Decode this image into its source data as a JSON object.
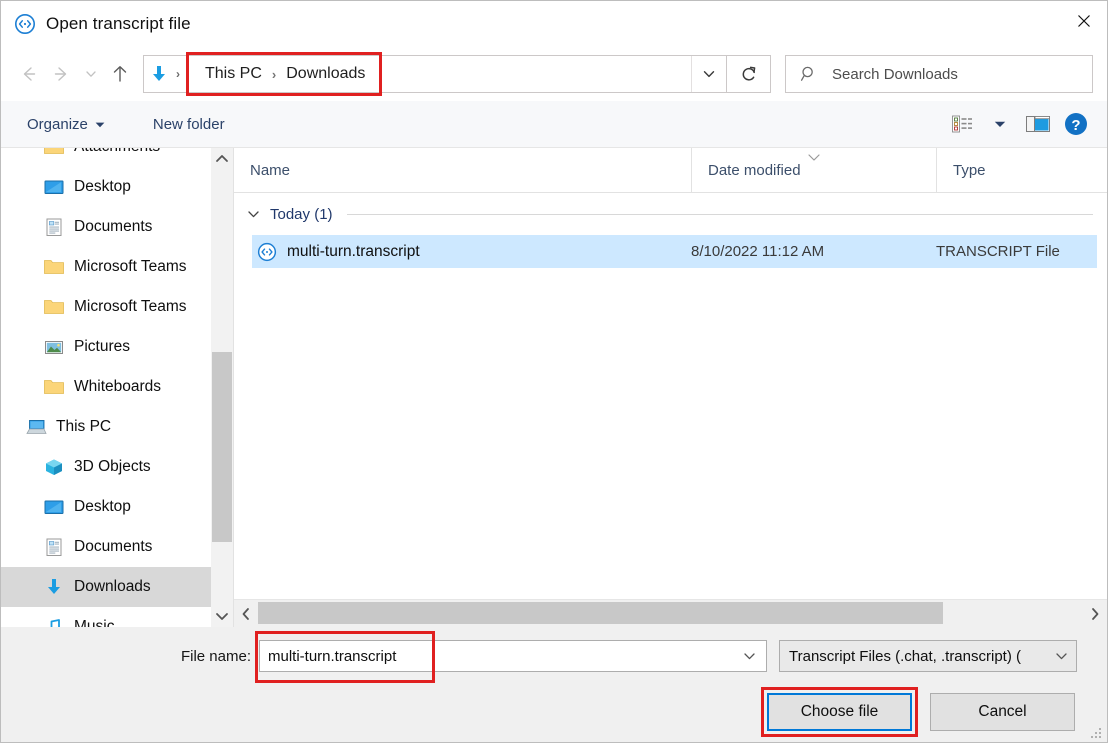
{
  "window": {
    "title": "Open transcript file",
    "title_icon": "transcript-file-icon",
    "close_label": "✕"
  },
  "nav": {
    "back_label": "Back",
    "forward_label": "Forward",
    "recent_label": "Recent locations",
    "up_label": "Up",
    "address_icon": "downloads-arrow-icon",
    "breadcrumbs": [
      "This PC",
      "Downloads"
    ],
    "breadcrumb_separator": "›",
    "dropdown_label": "Previous locations",
    "refresh_label": "Refresh",
    "highlight_color": "#e02020"
  },
  "search": {
    "placeholder": "Search Downloads",
    "value": "",
    "icon": "search-icon"
  },
  "commandbar": {
    "organize_label": "Organize",
    "new_folder_label": "New folder",
    "view_label": "Change your view",
    "view_dropdown_label": "More options",
    "preview_pane_label": "Show the preview pane",
    "help_label": "Get help",
    "help_glyph": "?"
  },
  "sidebar": {
    "items": [
      {
        "label": "Attachments",
        "icon": "folder-icon",
        "level": "child",
        "selected": false
      },
      {
        "label": "Desktop",
        "icon": "desktop-icon",
        "level": "child",
        "selected": false
      },
      {
        "label": "Documents",
        "icon": "documents-icon",
        "level": "child",
        "selected": false
      },
      {
        "label": "Microsoft Teams",
        "icon": "folder-icon",
        "level": "child",
        "selected": false
      },
      {
        "label": "Microsoft Teams",
        "icon": "folder-icon",
        "level": "child",
        "selected": false
      },
      {
        "label": "Pictures",
        "icon": "pictures-icon",
        "level": "child",
        "selected": false
      },
      {
        "label": "Whiteboards",
        "icon": "folder-icon",
        "level": "child",
        "selected": false
      },
      {
        "label": "This PC",
        "icon": "this-pc-icon",
        "level": "root",
        "selected": false
      },
      {
        "label": "3D Objects",
        "icon": "3d-objects-icon",
        "level": "child",
        "selected": false
      },
      {
        "label": "Desktop",
        "icon": "desktop-icon",
        "level": "child",
        "selected": false
      },
      {
        "label": "Documents",
        "icon": "documents-icon",
        "level": "child",
        "selected": false
      },
      {
        "label": "Downloads",
        "icon": "downloads-arrow-icon",
        "level": "child",
        "selected": true
      },
      {
        "label": "Music",
        "icon": "music-icon",
        "level": "child",
        "selected": false
      }
    ]
  },
  "filelist": {
    "columns": [
      {
        "label": "Name",
        "sorted": false
      },
      {
        "label": "Date modified",
        "sorted": true
      },
      {
        "label": "Type",
        "sorted": false
      }
    ],
    "group": {
      "label": "Today (1)",
      "expanded": true
    },
    "rows": [
      {
        "name": "multi-turn.transcript",
        "date_modified": "8/10/2022 11:12 AM",
        "type": "TRANSCRIPT File",
        "icon": "transcript-file-icon",
        "selected": true
      }
    ]
  },
  "footer": {
    "file_name_label": "File name:",
    "file_name_value": "multi-turn.transcript",
    "file_name_placeholder": "",
    "file_type_value": "Transcript Files (.chat, .transcript) (",
    "choose_button_label": "Choose file",
    "cancel_button_label": "Cancel",
    "focus_color": "#0078d7",
    "highlight_color": "#e02020"
  }
}
